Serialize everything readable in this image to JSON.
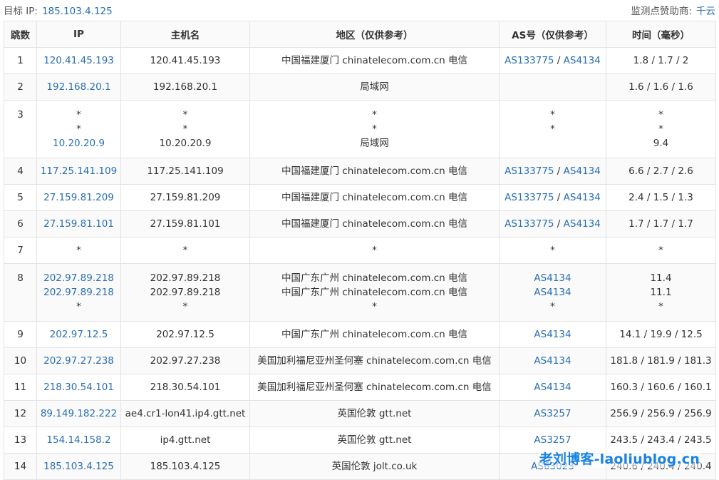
{
  "header": {
    "target_label": "目标 IP:",
    "target_ip": "185.103.4.125",
    "sponsor_label": "监测点赞助商:",
    "sponsor_name": "千云"
  },
  "columns": [
    "跳数",
    "IP",
    "主机名",
    "地区（仅供参考）",
    "AS号（仅供参考）",
    "时间（毫秒）"
  ],
  "hops": [
    {
      "hop": "1",
      "ip": [
        "120.41.45.193"
      ],
      "host": [
        "120.41.45.193"
      ],
      "region": [
        "中国福建厦门 chinatelecom.com.cn 电信"
      ],
      "as": [
        [
          "AS133775",
          "AS4134"
        ]
      ],
      "time": [
        "1.8 / 1.7 / 2"
      ]
    },
    {
      "hop": "2",
      "ip": [
        "192.168.20.1"
      ],
      "host": [
        "192.168.20.1"
      ],
      "region": [
        "局域网"
      ],
      "as": [
        []
      ],
      "time": [
        "1.6 / 1.6 / 1.6"
      ]
    },
    {
      "hop": "3",
      "ip": [
        "*",
        "*",
        "10.20.20.9"
      ],
      "host": [
        "*",
        "*",
        "10.20.20.9"
      ],
      "region": [
        "*",
        "*",
        "局域网"
      ],
      "as": [
        [
          "*"
        ],
        [
          "*"
        ],
        []
      ],
      "time": [
        "*",
        "*",
        "9.4"
      ]
    },
    {
      "hop": "4",
      "ip": [
        "117.25.141.109"
      ],
      "host": [
        "117.25.141.109"
      ],
      "region": [
        "中国福建厦门 chinatelecom.com.cn 电信"
      ],
      "as": [
        [
          "AS133775",
          "AS4134"
        ]
      ],
      "time": [
        "6.6 / 2.7 / 2.6"
      ]
    },
    {
      "hop": "5",
      "ip": [
        "27.159.81.209"
      ],
      "host": [
        "27.159.81.209"
      ],
      "region": [
        "中国福建厦门 chinatelecom.com.cn 电信"
      ],
      "as": [
        [
          "AS133775",
          "AS4134"
        ]
      ],
      "time": [
        "2.4 / 1.5 / 1.3"
      ]
    },
    {
      "hop": "6",
      "ip": [
        "27.159.81.101"
      ],
      "host": [
        "27.159.81.101"
      ],
      "region": [
        "中国福建厦门 chinatelecom.com.cn 电信"
      ],
      "as": [
        [
          "AS133775",
          "AS4134"
        ]
      ],
      "time": [
        "1.7 / 1.7 / 1.7"
      ]
    },
    {
      "hop": "7",
      "ip": [
        "*"
      ],
      "host": [
        "*"
      ],
      "region": [
        "*"
      ],
      "as": [
        [
          "*"
        ]
      ],
      "time": [
        "*"
      ]
    },
    {
      "hop": "8",
      "ip": [
        "202.97.89.218",
        "202.97.89.218",
        "*"
      ],
      "host": [
        "202.97.89.218",
        "202.97.89.218",
        "*"
      ],
      "region": [
        "中国广东广州 chinatelecom.com.cn 电信",
        "中国广东广州 chinatelecom.com.cn 电信",
        "*"
      ],
      "as": [
        [
          "AS4134"
        ],
        [
          "AS4134"
        ],
        [
          "*"
        ]
      ],
      "time": [
        "11.4",
        "11.1",
        "*"
      ]
    },
    {
      "hop": "9",
      "ip": [
        "202.97.12.5"
      ],
      "host": [
        "202.97.12.5"
      ],
      "region": [
        "中国广东广州 chinatelecom.com.cn 电信"
      ],
      "as": [
        [
          "AS4134"
        ]
      ],
      "time": [
        "14.1 / 19.9 / 12.5"
      ]
    },
    {
      "hop": "10",
      "ip": [
        "202.97.27.238"
      ],
      "host": [
        "202.97.27.238"
      ],
      "region": [
        "美国加利福尼亚州圣何塞 chinatelecom.com.cn 电信"
      ],
      "as": [
        [
          "AS4134"
        ]
      ],
      "time": [
        "181.8 / 181.9 / 181.3"
      ]
    },
    {
      "hop": "11",
      "ip": [
        "218.30.54.101"
      ],
      "host": [
        "218.30.54.101"
      ],
      "region": [
        "美国加利福尼亚州圣何塞 chinatelecom.com.cn 电信"
      ],
      "as": [
        [
          "AS4134"
        ]
      ],
      "time": [
        "160.3 / 160.6 / 160.1"
      ]
    },
    {
      "hop": "12",
      "ip": [
        "89.149.182.222"
      ],
      "host": [
        "ae4.cr1-lon41.ip4.gtt.net"
      ],
      "region": [
        "英国伦敦 gtt.net"
      ],
      "as": [
        [
          "AS3257"
        ]
      ],
      "time": [
        "256.9 / 256.9 / 256.9"
      ]
    },
    {
      "hop": "13",
      "ip": [
        "154.14.158.2"
      ],
      "host": [
        "ip4.gtt.net"
      ],
      "region": [
        "英国伦敦 gtt.net"
      ],
      "as": [
        [
          "AS3257"
        ]
      ],
      "time": [
        "243.5 / 243.4 / 243.5"
      ]
    },
    {
      "hop": "14",
      "ip": [
        "185.103.4.125"
      ],
      "host": [
        "185.103.4.125"
      ],
      "region": [
        "英国伦敦 jolt.co.uk"
      ],
      "as": [
        [
          "AS63023"
        ]
      ],
      "time": [
        "240.6 / 240.4 / 240.4"
      ]
    }
  ],
  "watermark": "老刘博客-laoliublog.cn",
  "colors": {
    "link": "#2a6fb0",
    "border": "#e3e3e3",
    "row_alt": "#fafafa",
    "watermark": "#1a82e2"
  }
}
